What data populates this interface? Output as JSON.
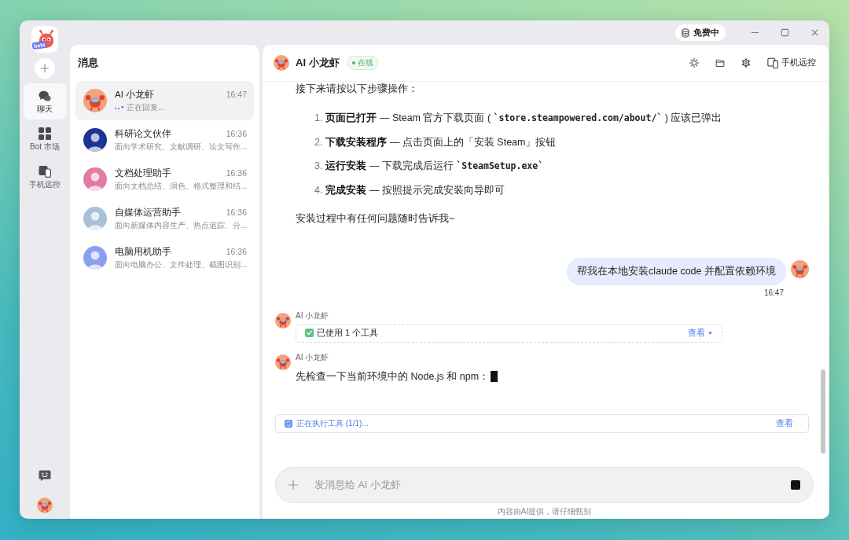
{
  "titlebar": {
    "plan": "免费中"
  },
  "logo": {
    "badge": "beta"
  },
  "rail": {
    "items": [
      {
        "kind": "chat",
        "label": "聊天",
        "selected": true
      },
      {
        "kind": "market",
        "label": "Bot 市场",
        "selected": false
      },
      {
        "kind": "remote",
        "label": "手机远控",
        "selected": false
      }
    ],
    "bottom": [
      {
        "kind": "feedback"
      },
      {
        "kind": "avatar"
      }
    ]
  },
  "messages": {
    "title": "消息",
    "items": [
      {
        "kind": "mascot",
        "color": "#f3a27d",
        "name": "AI 小龙虾",
        "time": "16:47",
        "preview": "正在回复...",
        "typing": true,
        "selected": true
      },
      {
        "kind": "person",
        "color": "#1d3492",
        "name": "科研论文伙伴",
        "time": "16:36",
        "preview": "面向学术研究、文献调研、论文写作...",
        "typing": false,
        "selected": false
      },
      {
        "kind": "person",
        "color": "#e27aa6",
        "name": "文档处理助手",
        "time": "16:36",
        "preview": "面向文档总结、润色、格式整理和结...",
        "typing": false,
        "selected": false
      },
      {
        "kind": "person",
        "color": "#a9c0d8",
        "name": "自媒体运营助手",
        "time": "16:36",
        "preview": "面向新媒体内容生产、热点追踪、分...",
        "typing": false,
        "selected": false
      },
      {
        "kind": "person",
        "color": "#8b9ff0",
        "name": "电脑用机助手",
        "time": "16:36",
        "preview": "面向电脑办公、文件处理、截图识别...",
        "typing": false,
        "selected": false
      }
    ]
  },
  "chat": {
    "title": "AI 小龙虾",
    "status": "在线",
    "online": true,
    "actions": [
      {
        "kind": "spinner"
      },
      {
        "kind": "folder"
      },
      {
        "kind": "settings"
      },
      {
        "kind": "remote",
        "label": "手机远控"
      }
    ],
    "timeline": [
      {
        "kind": "steps",
        "intro": "接下来请按以下步骤操作：",
        "steps": [
          {
            "number": "1.",
            "parts": [
              {
                "kind": "bold",
                "text": "页面已打开"
              },
              {
                "kind": "plain",
                "text": " — Steam 官方下载页面 ( "
              },
              {
                "kind": "code",
                "text": "`store.steampowered.com/about/`"
              },
              {
                "kind": "plain",
                "text": " ) 应该已弹出"
              }
            ]
          },
          {
            "number": "2.",
            "parts": [
              {
                "kind": "bold",
                "text": "下载安装程序"
              },
              {
                "kind": "plain",
                "text": " — 点击页面上的「安装 Steam」按钮"
              }
            ]
          },
          {
            "number": "3.",
            "parts": [
              {
                "kind": "bold",
                "text": "运行安装"
              },
              {
                "kind": "plain",
                "text": " — 下载完成后运行 "
              },
              {
                "kind": "code",
                "text": "`SteamSetup.exe`"
              }
            ]
          },
          {
            "number": "4.",
            "parts": [
              {
                "kind": "bold",
                "text": "完成安装"
              },
              {
                "kind": "plain",
                "text": " — 按照提示完成安装向导即可"
              }
            ]
          }
        ],
        "outro": "安装过程中有任何问题随时告诉我~"
      },
      {
        "kind": "user",
        "text": "帮我在本地安装claude code 并配置依赖环境",
        "time": "16:47"
      },
      {
        "kind": "tool",
        "sender": "AI 小龙虾",
        "text": "已使用 1 个工具",
        "action": "查看"
      },
      {
        "kind": "text",
        "sender": "AI 小龙虾",
        "text": "先检查一下当前环境中的 Node.js 和 npm：",
        "streaming": true
      }
    ],
    "tool_status": {
      "text": "正在执行工具 (1/1)...",
      "action": "查看"
    },
    "composer": {
      "placeholder": "发消息给 AI 小龙虾"
    },
    "disclaimer": "内容由AI提供，请仔细甄别"
  }
}
